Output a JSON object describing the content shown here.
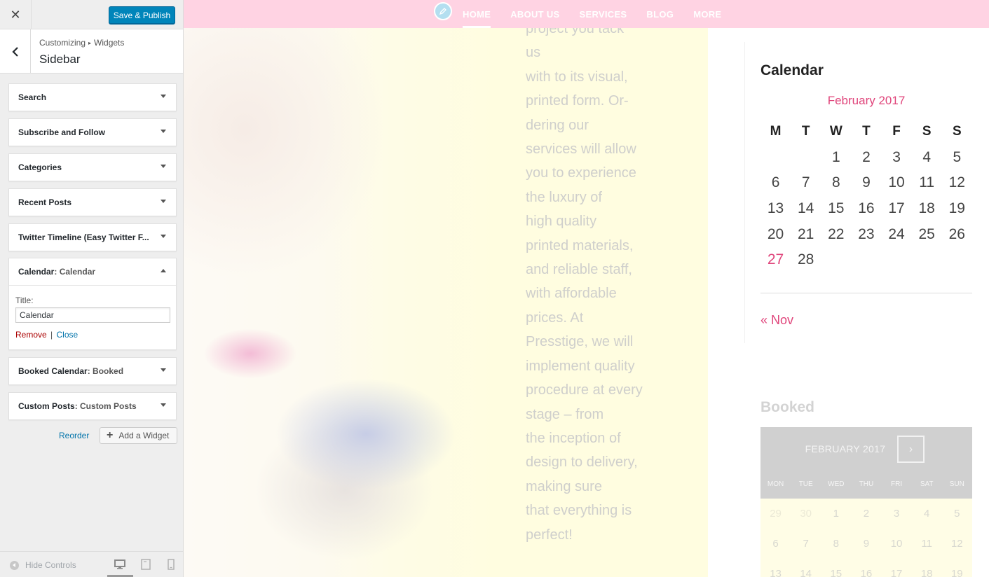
{
  "customizer": {
    "save_label": "Save & Publish",
    "breadcrumb": {
      "root": "Customizing",
      "separator": "▸",
      "section": "Widgets"
    },
    "panel_title": "Sidebar",
    "widgets": [
      {
        "title": "Search",
        "subtitle": ""
      },
      {
        "title": "Subscribe and Follow",
        "subtitle": ""
      },
      {
        "title": "Categories",
        "subtitle": ""
      },
      {
        "title": "Recent Posts",
        "subtitle": ""
      },
      {
        "title": "Twitter Timeline (Easy Twitter F...",
        "subtitle": ""
      },
      {
        "title": "Calendar",
        "subtitle": ": Calendar",
        "expanded": true
      },
      {
        "title": "Booked Calendar",
        "subtitle": ": Booked"
      },
      {
        "title": "Custom Posts",
        "subtitle": ": Custom Posts"
      }
    ],
    "expanded_widget": {
      "field_label": "Title:",
      "field_value": "Calendar",
      "remove_label": "Remove",
      "separator": "|",
      "close_label": "Close"
    },
    "reorder_label": "Reorder",
    "add_widget_label": "Add a Widget",
    "hide_controls_label": "Hide Controls"
  },
  "preview": {
    "nav": [
      "HOME",
      "ABOUT US",
      "SERVICES",
      "BLOG",
      "MORE"
    ],
    "body_lines": [
      "project you tack",
      "us",
      "with to its visual,",
      "printed form. Or-",
      "dering our",
      "services will allow",
      "you to experience",
      "the luxury of",
      "high quality",
      "printed materials,",
      "and reliable staff,",
      "with affordable",
      "prices. At",
      "Presstige, we will",
      "implement quality",
      "procedure at every",
      "stage – from",
      "the inception of",
      "design to delivery,",
      "making sure",
      "that everything is",
      "perfect!"
    ],
    "calendar": {
      "title": "Calendar",
      "caption": "February 2017",
      "weekdays": [
        "M",
        "T",
        "W",
        "T",
        "F",
        "S",
        "S"
      ],
      "weeks": [
        [
          "",
          "",
          "1",
          "2",
          "3",
          "4",
          "5"
        ],
        [
          "6",
          "7",
          "8",
          "9",
          "10",
          "11",
          "12"
        ],
        [
          "13",
          "14",
          "15",
          "16",
          "17",
          "18",
          "19"
        ],
        [
          "20",
          "21",
          "22",
          "23",
          "24",
          "25",
          "26"
        ],
        [
          "27",
          "28",
          "",
          "",
          "",
          "",
          ""
        ]
      ],
      "today": "27",
      "prev_link": "« Nov"
    },
    "booked": {
      "title": "Booked",
      "month": "FEBRUARY 2017",
      "next": "›",
      "weekdays": [
        "MON",
        "TUE",
        "WED",
        "THU",
        "FRI",
        "SAT",
        "SUN"
      ],
      "weeks": [
        [
          "29",
          "30",
          "1",
          "2",
          "3",
          "4",
          "5"
        ],
        [
          "6",
          "7",
          "8",
          "9",
          "10",
          "11",
          "12"
        ],
        [
          "13",
          "14",
          "15",
          "16",
          "17",
          "18",
          "19"
        ]
      ]
    }
  },
  "colors": {
    "accent": "#e0457b",
    "wp_blue": "#0085ba",
    "nav_bg": "#ffd3e3",
    "remove_red": "#aa0000"
  }
}
